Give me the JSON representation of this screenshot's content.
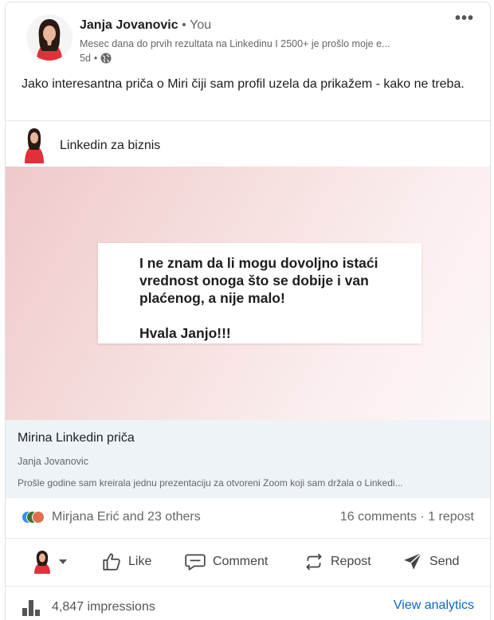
{
  "post": {
    "author_name": "Janja Jovanovic",
    "separator": "•",
    "author_badge": "You",
    "author_headline": "Mesec dana do prvih rezultata na Linkedinu I 2500+ je prošlo moje e...",
    "time_ago": "5d",
    "time_separator": "•",
    "visibility_icon": "globe-icon",
    "more_icon": "•••",
    "text": "Jako interesantna priča o Miri čiji sam profil uzela da prikažem - kako ne treba."
  },
  "document": {
    "publisher": "Linkedin za biznis",
    "quote_lines": [
      "I ne znam da li mogu dovoljno istaći",
      "vrednost onoga što se dobije i van",
      "plaćenog, a nije malo!"
    ],
    "quote_thanks": "Hvala Janjo!!!",
    "gradient_colors": [
      "#efc9c9",
      "#fdf7f7"
    ]
  },
  "article": {
    "title": "Mirina Linkedin priča",
    "author": "Janja Jovanovic",
    "description": "Prošle godine sam kreirala jednu prezentaciju za otvoreni Zoom koji sam držala o Linkedi..."
  },
  "social": {
    "reactions_label": "Mirjana Erić and 23 others",
    "comments": "16 comments",
    "dot": "·",
    "reposts": "1 repost"
  },
  "actions": {
    "like": "Like",
    "comment": "Comment",
    "repost": "Repost",
    "send": "Send"
  },
  "footer": {
    "impressions": "4,847 impressions",
    "view_analytics": "View analytics"
  },
  "colors": {
    "link": "#0a66c2",
    "like_reaction": "#378fe9",
    "love_reaction": "#df704d",
    "article_bg": "#eef3f8"
  }
}
